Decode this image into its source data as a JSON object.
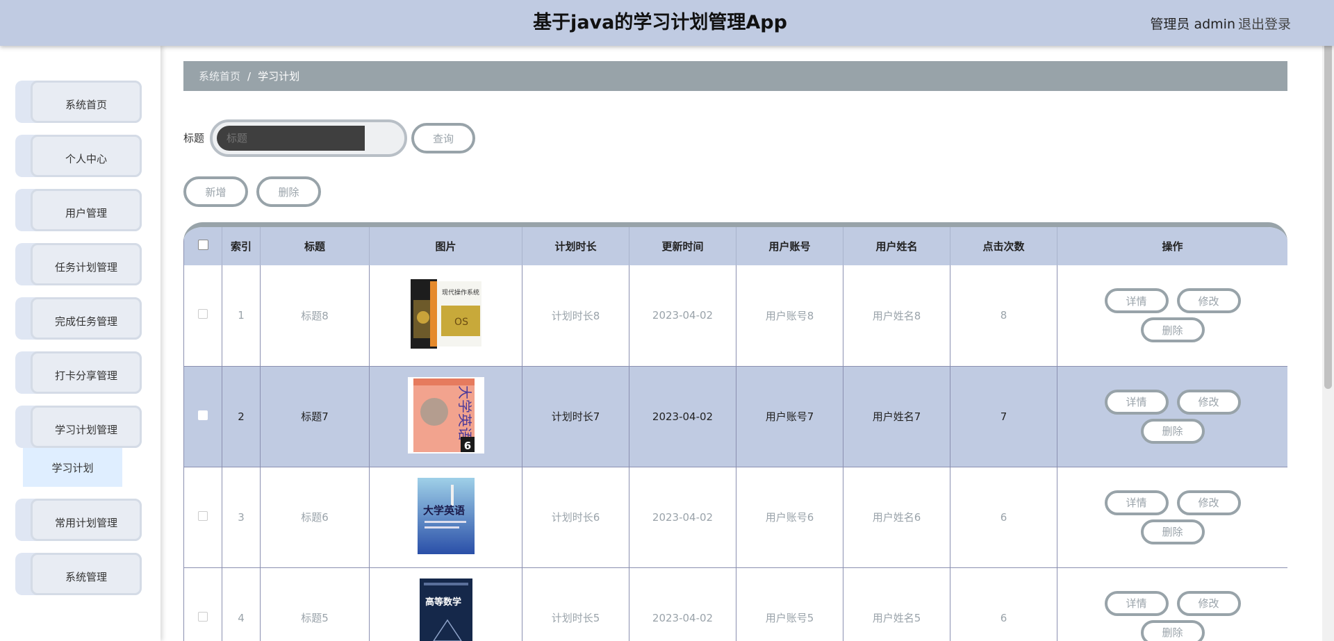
{
  "header": {
    "title": "基于java的学习计划管理App",
    "admin_label": "管理员 admin",
    "logout_label": "退出登录"
  },
  "sidebar": {
    "items": [
      {
        "label": "系统首页"
      },
      {
        "label": "个人中心"
      },
      {
        "label": "用户管理"
      },
      {
        "label": "任务计划管理"
      },
      {
        "label": "完成任务管理"
      },
      {
        "label": "打卡分享管理"
      },
      {
        "label": "学习计划管理"
      },
      {
        "label": "常用计划管理"
      },
      {
        "label": "系统管理"
      }
    ],
    "submenu_active": "学习计划"
  },
  "breadcrumb": {
    "home": "系统首页",
    "separator": "/",
    "current": "学习计划"
  },
  "search": {
    "label": "标题",
    "placeholder": "标题",
    "query_button": "查询"
  },
  "actions": {
    "add_button": "新增",
    "delete_button": "删除"
  },
  "table": {
    "columns": [
      "索引",
      "标题",
      "图片",
      "计划时长",
      "更新时间",
      "用户账号",
      "用户姓名",
      "点击次数",
      "操作"
    ],
    "rows": [
      {
        "index": "1",
        "title": "标题8",
        "duration": "计划时长8",
        "updated": "2023-04-02",
        "account": "用户账号8",
        "name": "用户姓名8",
        "clicks": "8"
      },
      {
        "index": "2",
        "title": "标题7",
        "duration": "计划时长7",
        "updated": "2023-04-02",
        "account": "用户账号7",
        "name": "用户姓名7",
        "clicks": "7"
      },
      {
        "index": "3",
        "title": "标题6",
        "duration": "计划时长6",
        "updated": "2023-04-02",
        "account": "用户账号6",
        "name": "用户姓名6",
        "clicks": "6"
      },
      {
        "index": "4",
        "title": "标题5",
        "duration": "计划时长5",
        "updated": "2023-04-02",
        "account": "用户账号5",
        "name": "用户姓名5",
        "clicks": "6"
      }
    ],
    "row_buttons": {
      "detail": "详情",
      "edit": "修改",
      "delete": "删除"
    }
  },
  "book_covers": [
    {
      "title_text": "现代操作系统",
      "badge": "OS"
    },
    {
      "title_text": "大学英语",
      "badge": "6"
    },
    {
      "title_text": "大学英语"
    },
    {
      "title_text": "高等数学"
    }
  ],
  "colors": {
    "header_bg": "#c0cbe2",
    "breadcrumb_bg": "#98a3a9",
    "selected_row": "#c0cbe2",
    "button_border": "#98a3a9"
  }
}
